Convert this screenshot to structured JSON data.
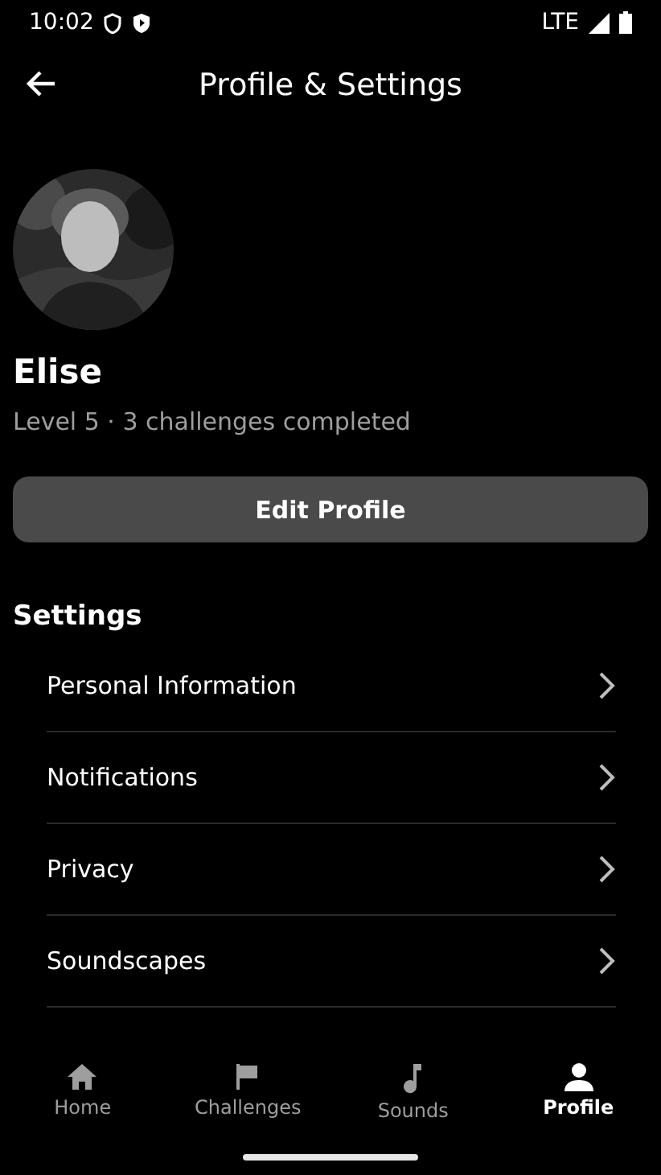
{
  "status_bar": {
    "time": "10:02",
    "network": "LTE"
  },
  "header": {
    "title": "Profile & Settings"
  },
  "profile": {
    "name": "Elise",
    "summary": "Level 5 · 3 challenges completed",
    "edit_button": "Edit Profile"
  },
  "settings": {
    "title": "Settings",
    "items": [
      {
        "label": "Personal Information"
      },
      {
        "label": "Notifications"
      },
      {
        "label": "Privacy"
      },
      {
        "label": "Soundscapes"
      }
    ]
  },
  "nav": [
    {
      "label": "Home",
      "selected": false
    },
    {
      "label": "Challenges",
      "selected": false
    },
    {
      "label": "Sounds",
      "selected": false
    },
    {
      "label": "Profile",
      "selected": true
    }
  ]
}
